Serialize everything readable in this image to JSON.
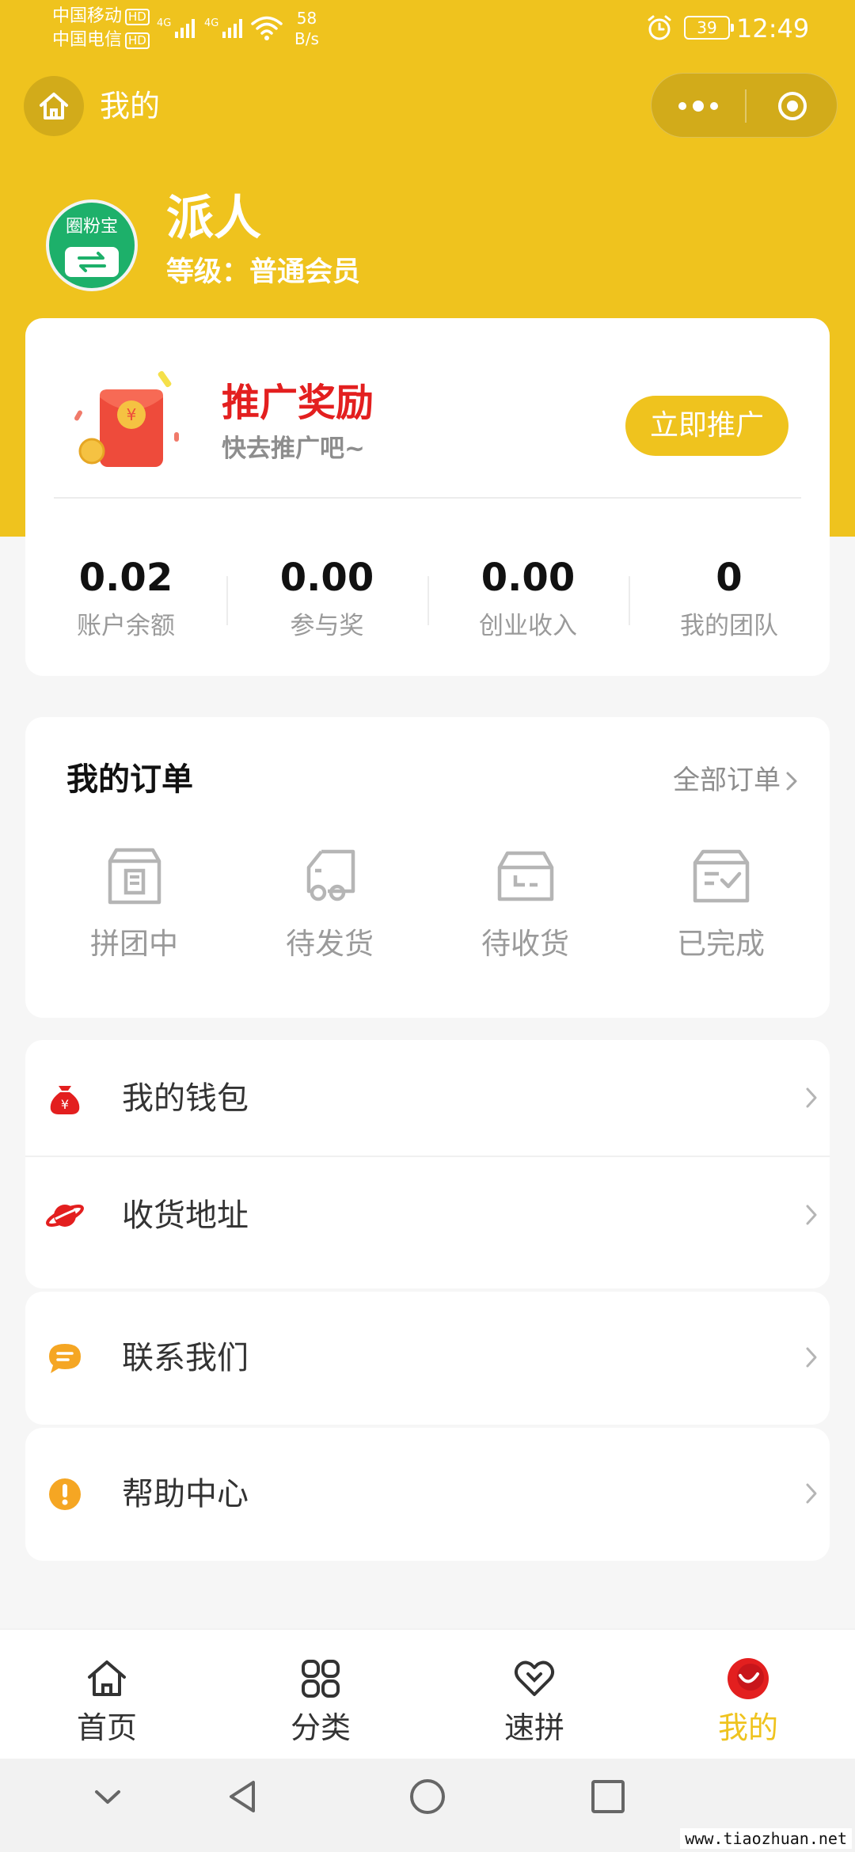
{
  "status_bar": {
    "carrier1": "中国移动",
    "carrier2": "中国电信",
    "hd": "HD",
    "net1": "4G",
    "net2": "4G",
    "speed_value": "58",
    "speed_unit": "B/s",
    "battery": "39",
    "time": "12:49"
  },
  "nav": {
    "title": "我的",
    "home_icon": "home-icon",
    "more_icon": "more-dots-icon",
    "close_icon": "target-circle-icon"
  },
  "profile": {
    "avatar_text": "圈粉宝",
    "name": "派人",
    "level": "等级：普通会员"
  },
  "promo": {
    "title": "推广奖励",
    "subtitle": "快去推广吧~",
    "button": "立即推广"
  },
  "stats": [
    {
      "value": "0.02",
      "label": "账户余额"
    },
    {
      "value": "0.00",
      "label": "参与奖"
    },
    {
      "value": "0.00",
      "label": "创业收入"
    },
    {
      "value": "0",
      "label": "我的团队"
    }
  ],
  "orders": {
    "title": "我的订单",
    "all_label": "全部订单",
    "items": [
      {
        "label": "拼团中",
        "icon": "package-icon"
      },
      {
        "label": "待发货",
        "icon": "truck-icon"
      },
      {
        "label": "待收货",
        "icon": "tray-icon"
      },
      {
        "label": "已完成",
        "icon": "box-check-icon"
      }
    ]
  },
  "menu": [
    {
      "label": "我的钱包",
      "icon": "money-bag-icon",
      "color": "#e31f1f"
    },
    {
      "label": "收货地址",
      "icon": "planet-icon",
      "color": "#e31f1f"
    },
    {
      "label": "联系我们",
      "icon": "chat-bubble-icon",
      "color": "#f5a623"
    },
    {
      "label": "帮助中心",
      "icon": "exclamation-icon",
      "color": "#f5a623"
    }
  ],
  "tabbar": [
    {
      "label": "首页",
      "icon": "home-icon",
      "active": false
    },
    {
      "label": "分类",
      "icon": "grid-icon",
      "active": false
    },
    {
      "label": "速拼",
      "icon": "heart-icon",
      "active": false
    },
    {
      "label": "我的",
      "icon": "profile-face-icon",
      "active": true
    }
  ],
  "watermark": "www.tiaozhuan.net",
  "colors": {
    "brand": "#efc31e",
    "promo_title": "#e31f1f",
    "muted": "#9a9a9a"
  }
}
